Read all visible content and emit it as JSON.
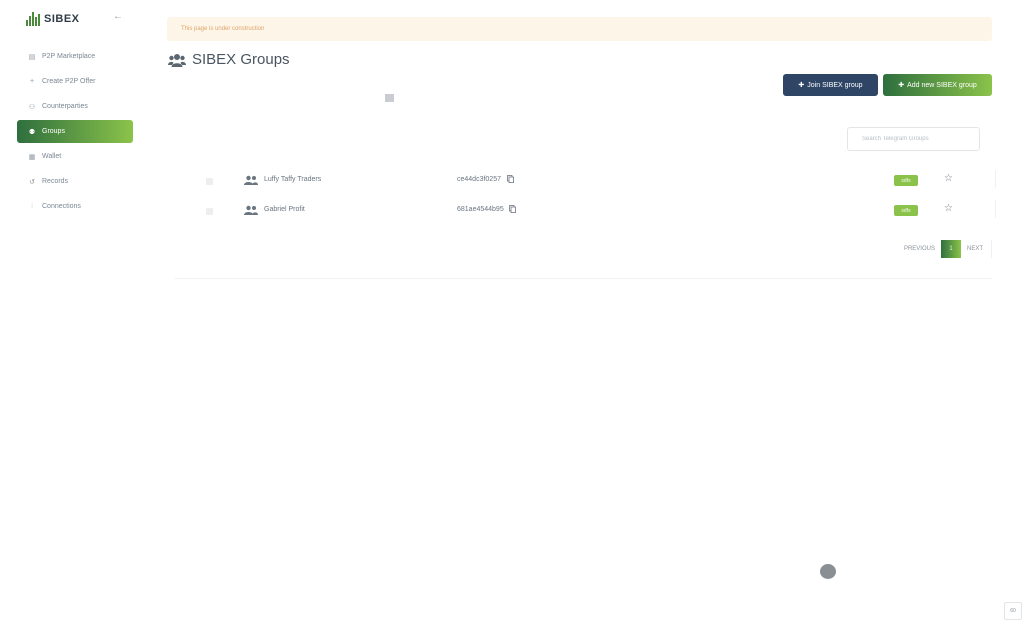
{
  "brand": {
    "name": "SIBEX",
    "collapse_icon": "arrow-left-icon"
  },
  "sidebar": {
    "items": [
      {
        "label": "P2P Marketplace",
        "icon": "store-icon",
        "glyph": "▤",
        "active": false
      },
      {
        "label": "Create P2P Offer",
        "icon": "plus-icon",
        "glyph": "+",
        "active": false
      },
      {
        "label": "Counterparties",
        "icon": "users-icon",
        "glyph": "⚇",
        "active": false
      },
      {
        "label": "Groups",
        "icon": "groups-icon",
        "glyph": "⚉",
        "active": true
      },
      {
        "label": "Wallet",
        "icon": "wallet-icon",
        "glyph": "▦",
        "active": false
      },
      {
        "label": "Records",
        "icon": "history-icon",
        "glyph": "↺",
        "active": false
      },
      {
        "label": "Connections",
        "icon": "sliders-icon",
        "glyph": "⫶",
        "active": false
      }
    ]
  },
  "banner": {
    "text": "This page is under construction"
  },
  "page": {
    "title": "SIBEX Groups",
    "title_icon": "users-icon"
  },
  "buttons": {
    "join": {
      "label": "Join SIBEX group",
      "icon": "user-plus-icon"
    },
    "add": {
      "label": "Add new SIBEX group",
      "icon": "users-plus-icon"
    }
  },
  "search": {
    "placeholder": "Search Telegram Groups",
    "value": ""
  },
  "groups": [
    {
      "name": "Luffy Taffy Traders",
      "id": "ce44dc3f0257",
      "badge": "sdfs",
      "copy_icon": "copy-icon",
      "star_icon": "star-icon"
    },
    {
      "name": "Gabriel Profit",
      "id": "681ae4544b95",
      "badge": "sdfs",
      "copy_icon": "copy-icon",
      "star_icon": "star-icon"
    }
  ],
  "pagination": {
    "previous": "PREVIOUS",
    "current": "1",
    "next": "NEXT"
  },
  "corner": {
    "label": "60"
  },
  "colors": {
    "accent_dark": "#2e6f3e",
    "accent_light": "#8bc34a",
    "navy": "#2f4566",
    "banner_bg": "#fdf5e8",
    "banner_text": "#e0a56a"
  }
}
